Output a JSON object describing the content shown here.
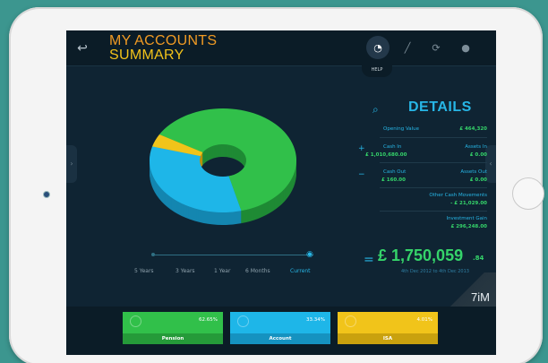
{
  "header": {
    "title_line1": "MY ACCOUNTS",
    "title_line2": "SUMMARY",
    "help_label": "HELP"
  },
  "colors": {
    "pension": "#31c04a",
    "account": "#1eb6e8",
    "isa": "#f1c41a",
    "accent": "#27b6e6",
    "positive": "#35d46a"
  },
  "nav_icons": [
    "pie-chart-icon",
    "line-chart-icon",
    "refresh-icon",
    "lightbulb-icon"
  ],
  "timeline": {
    "labels": [
      "5 Years",
      "3 Years",
      "1 Year",
      "6 Months",
      "Current"
    ],
    "selected": "Current"
  },
  "details": {
    "title": "DETAILS",
    "opening_label": "Opening Value",
    "opening_value": "£ 464,320",
    "cash_in_label": "Cash In",
    "cash_in_value": "£ 1,010,680.00",
    "assets_in_label": "Assets In",
    "assets_in_value": "£ 0.00",
    "cash_out_label": "Cash Out",
    "cash_out_value": "£ 160.00",
    "assets_out_label": "Assets Out",
    "assets_out_value": "£ 0.00",
    "other_label": "Other Cash Movements",
    "other_value": "- £ 21,029.00",
    "gain_label": "Investment Gain",
    "gain_value": "£ 296,248.00",
    "plus": "+",
    "minus": "−",
    "equals": "=",
    "total_main": "£ 1,750,059",
    "total_dec": ".84",
    "date_range": "4th Dec 2012 to 4th Dec 2013"
  },
  "logo_text": "7iM",
  "accounts": [
    {
      "name": "Pension",
      "percent": "62.65%",
      "share": 62.65
    },
    {
      "name": "Account",
      "percent": "33.34%",
      "share": 33.34
    },
    {
      "name": "ISA",
      "percent": "4.01%",
      "share": 4.01
    }
  ],
  "chart_data": {
    "type": "pie",
    "categories": [
      "Pension",
      "Account",
      "ISA"
    ],
    "values": [
      62.65,
      33.34,
      4.01
    ]
  }
}
